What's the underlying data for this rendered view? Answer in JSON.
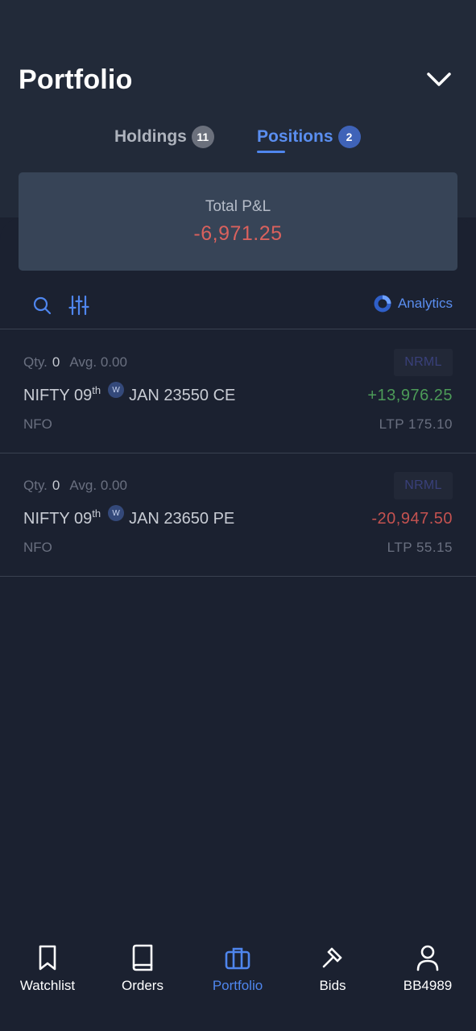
{
  "header": {
    "title": "Portfolio",
    "tabs": [
      {
        "label": "Holdings",
        "count": "11"
      },
      {
        "label": "Positions",
        "count": "2"
      }
    ]
  },
  "summary": {
    "label": "Total P&L",
    "value": "-6,971.25"
  },
  "toolbar": {
    "analytics_label": "Analytics"
  },
  "positions": [
    {
      "qty_label": "Qty.",
      "qty": "0",
      "avg": "Avg. 0.00",
      "product": "NRML",
      "symbol_prefix": "NIFTY 09",
      "symbol_sup": "th",
      "weekly": "W",
      "symbol_suffix": "JAN 23550 CE",
      "pnl": "+13,976.25",
      "exchange": "NFO",
      "ltp": "LTP 175.10"
    },
    {
      "qty_label": "Qty.",
      "qty": "0",
      "avg": "Avg. 0.00",
      "product": "NRML",
      "symbol_prefix": "NIFTY 09",
      "symbol_sup": "th",
      "weekly": "W",
      "symbol_suffix": "JAN 23650 PE",
      "pnl": "-20,947.50",
      "exchange": "NFO",
      "ltp": "LTP 55.15"
    }
  ],
  "nav": [
    {
      "label": "Watchlist",
      "icon": "bookmark-icon"
    },
    {
      "label": "Orders",
      "icon": "book-icon"
    },
    {
      "label": "Portfolio",
      "icon": "briefcase-icon"
    },
    {
      "label": "Bids",
      "icon": "gavel-icon"
    },
    {
      "label": "BB4989",
      "icon": "user-icon"
    }
  ],
  "colors": {
    "accent": "#4f86ee",
    "profit": "#4c9b58",
    "loss": "#c45250"
  }
}
